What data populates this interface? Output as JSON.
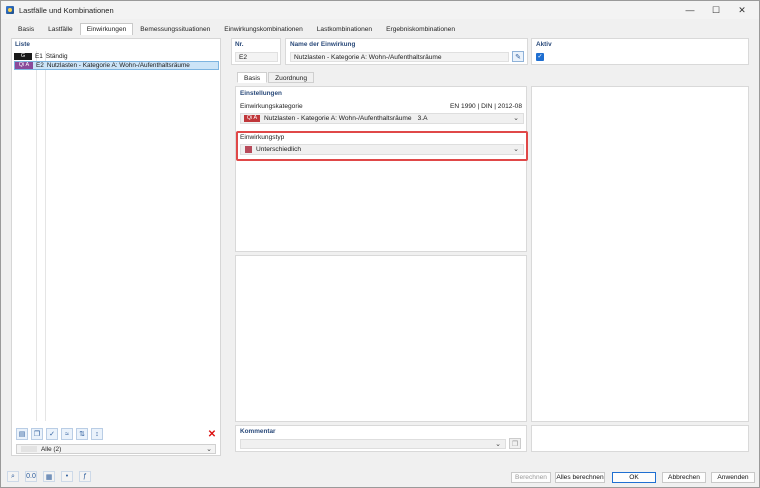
{
  "window": {
    "title": "Lastfälle und Kombinationen",
    "minimize": "—",
    "maximize": "☐",
    "close": "✕"
  },
  "tabs": [
    "Basis",
    "Lastfälle",
    "Einwirkungen",
    "Bemessungssituationen",
    "Einwirkungskombinationen",
    "Lastkombinationen",
    "Ergebniskombinationen"
  ],
  "active_tab": "Einwirkungen",
  "list_panel": {
    "label": "Liste",
    "items": [
      {
        "badge": "G",
        "badge_color": "#1a1a1a",
        "code": "E1",
        "name": "Ständig"
      },
      {
        "badge": "Qi A",
        "badge_color": "#8a4a9a",
        "code": "E2",
        "name": "Nutzlasten - Kategorie A: Wohn-/Aufenthaltsräume"
      }
    ],
    "filter_value": "Alle (2)"
  },
  "header": {
    "nr_label": "Nr.",
    "nr_value": "E2",
    "name_label": "Name der Einwirkung",
    "name_value": "Nutzlasten - Kategorie A: Wohn-/Aufenthaltsräume",
    "aktiv_label": "Aktiv"
  },
  "subtabs": [
    "Basis",
    "Zuordnung"
  ],
  "settings": {
    "section_label": "Einstellungen",
    "category_label": "Einwirkungskategorie",
    "norm": "EN 1990 | DIN | 2012-08",
    "category_badge": "Qi A",
    "category_badge_color": "#c0373a",
    "category_value": "Nutzlasten - Kategorie A: Wohn-/Aufenthaltsräume",
    "category_code": "3.A",
    "type_label": "Einwirkungstyp",
    "type_value": "Unterschiedlich",
    "type_color": "#b84a5a"
  },
  "comment": {
    "label": "Kommentar"
  },
  "footer": {
    "berechnen": "Berechnen",
    "alle_berechnen": "Alles berechnen",
    "ok": "OK",
    "abbrechen": "Abbrechen",
    "anwenden": "Anwenden"
  }
}
